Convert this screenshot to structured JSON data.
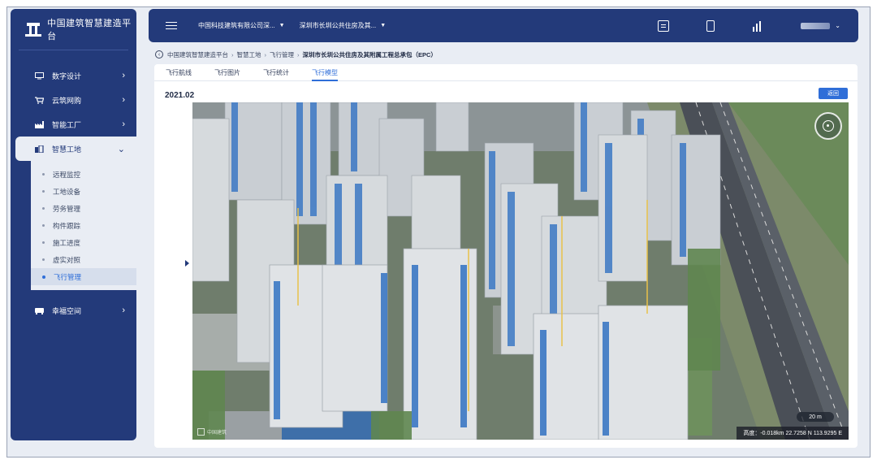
{
  "app": {
    "name": "中国建筑智慧建造平台"
  },
  "sidebar": {
    "items": [
      {
        "label": "数字设计",
        "icon": "screen-icon"
      },
      {
        "label": "云筑网购",
        "icon": "cart-icon"
      },
      {
        "label": "智能工厂",
        "icon": "factory-icon"
      },
      {
        "label": "智慧工地",
        "icon": "site-icon"
      },
      {
        "label": "幸福空间",
        "icon": "home-icon"
      }
    ],
    "sub_items": [
      {
        "label": "远程监控"
      },
      {
        "label": "工地设备"
      },
      {
        "label": "劳务管理"
      },
      {
        "label": "构件跟踪"
      },
      {
        "label": "施工进度"
      },
      {
        "label": "虚实对照"
      },
      {
        "label": "飞行管理"
      }
    ]
  },
  "topbar": {
    "org_select": "中国科技建筑有限公司深...",
    "project_select": "深圳市长圳公共住房及其...",
    "icons": [
      "document-icon",
      "phone-icon",
      "chart-icon"
    ]
  },
  "breadcrumb": {
    "items": [
      "中国建筑智慧建造平台",
      "智慧工地",
      "飞行管理",
      "深圳市长圳公共住房及其附属工程总承包（EPC）"
    ]
  },
  "tabs": [
    {
      "label": "飞行航线"
    },
    {
      "label": "飞行图片"
    },
    {
      "label": "飞行统计"
    },
    {
      "label": "飞行模型"
    }
  ],
  "content": {
    "date": "2021.02",
    "action_button": "返回"
  },
  "map": {
    "scale": "20 m",
    "coordinates": "高度：-0.018km 22.7258 N 113.9295 E",
    "watermark": "中国建筑"
  },
  "colors": {
    "sidebar": "#233a7a",
    "accent": "#2f6ed8",
    "page_bg": "#e9edf4"
  }
}
